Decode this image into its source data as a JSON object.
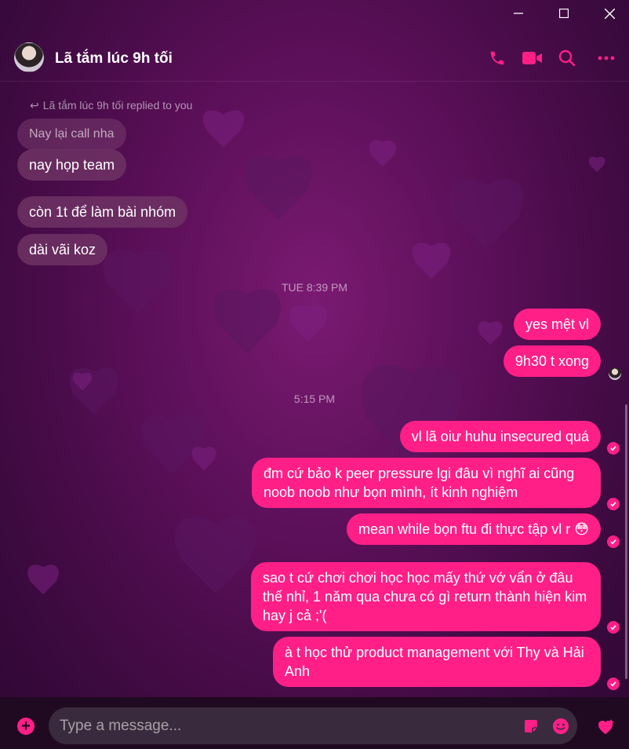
{
  "window": {
    "minimize_icon": "minimize-icon",
    "maximize_icon": "maximize-icon",
    "close_icon": "close-icon"
  },
  "header": {
    "contact_name": "Lã tắm lúc 9h tối",
    "icons": [
      "phone-icon",
      "video-icon",
      "search-icon",
      "more-icon"
    ]
  },
  "conversation": {
    "reply_note": "Lã tắm lúc 9h tối replied to you",
    "quoted_message": "Nay lại call nha",
    "incoming": [
      "nay họp team",
      "còn 1t để làm bài nhóm",
      "dài vãi koz"
    ],
    "time_1": "TUE 8:39 PM",
    "outgoing_1": [
      "yes mệt vl",
      "9h30 t xong"
    ],
    "time_2": "5:15 PM",
    "outgoing_2": [
      "vl lã oiư huhu insecured quá",
      "đm cứ bảo k peer pressure lgi đâu vì nghĩ ai cũng noob noob như bọn mình, ít kinh nghiệm",
      "mean while bọn ftu đi thực tập vl r 😳",
      "sao t cứ chơi chơi học học mấy thứ vớ vẩn ở đâu thế nhỉ, 1 năm qua chưa có gì return thành hiện kim hay j cả ;'(",
      "à t học thử product management với Thy và Hải Anh"
    ]
  },
  "composer": {
    "placeholder": "Type a message...",
    "icons": [
      "plus-icon",
      "sticker-icon",
      "emoji-icon",
      "heart-icon"
    ]
  },
  "colors": {
    "accent": "#ff1f87",
    "incoming_bubble": "#6e3264",
    "background": "#5a0f57"
  }
}
